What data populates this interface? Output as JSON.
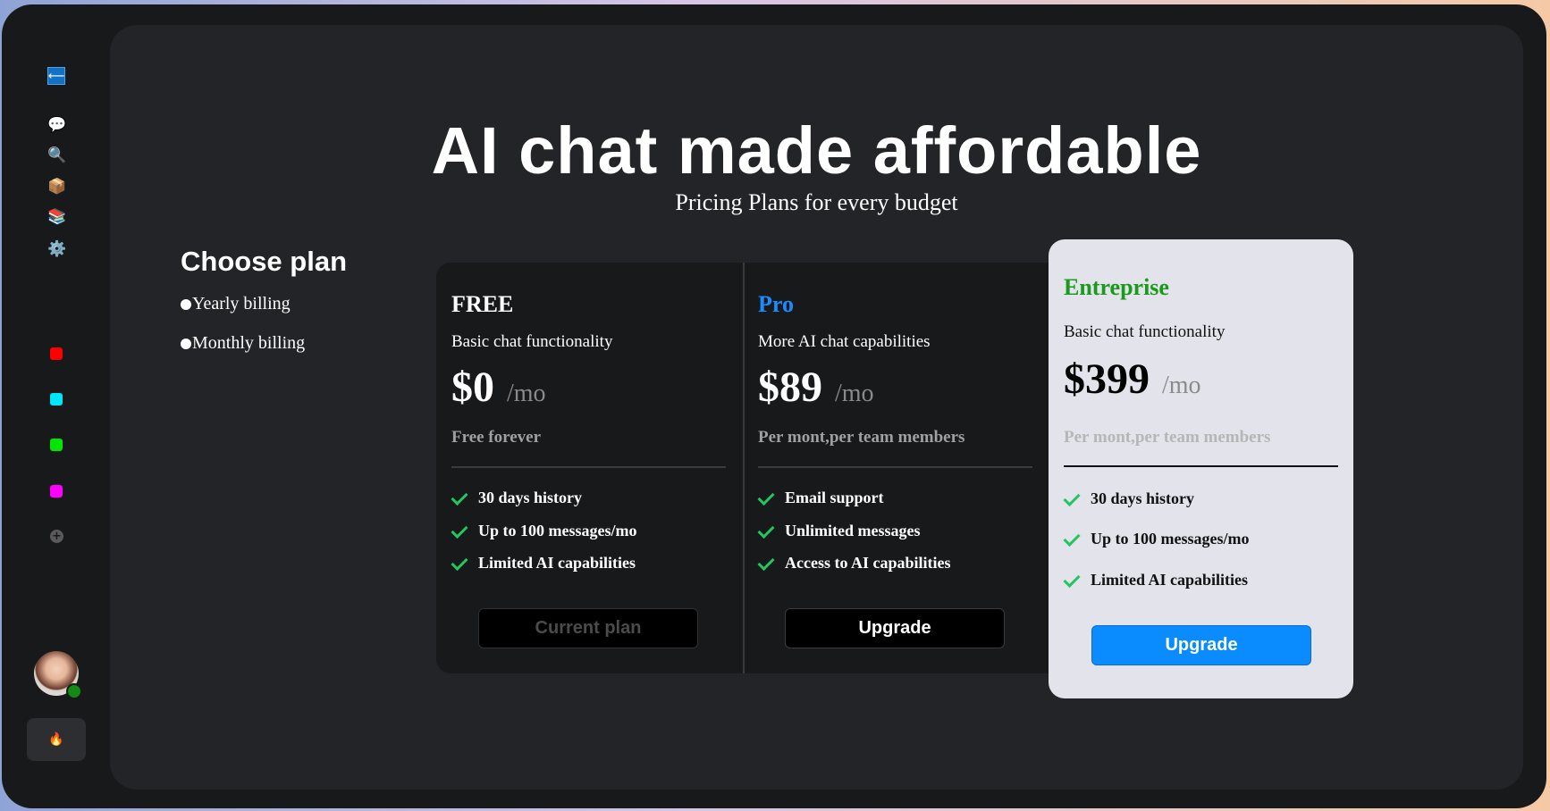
{
  "sidebar": {
    "icons": [
      "collapse-icon",
      "chat-icon",
      "search-icon",
      "package-icon",
      "books-icon",
      "gear-icon"
    ],
    "color_tags": [
      "#ff0000",
      "#00e5ff",
      "#00e600",
      "#ff00ff"
    ],
    "add_icon": "+",
    "fire_icon": "🔥"
  },
  "hero": {
    "title": "AI chat made affordable",
    "subtitle": "Pricing Plans for every budget"
  },
  "billing": {
    "heading": "Choose plan",
    "options": [
      "Yearly billing",
      "Monthly billing"
    ]
  },
  "plans": [
    {
      "name": "FREE",
      "name_color": "#ffffff",
      "description": "Basic chat functionality",
      "price": "$0",
      "per": "/mo",
      "note": "Free forever",
      "features": [
        "30 days history",
        "Up to 100 messages/mo",
        "Limited AI capabilities"
      ],
      "button": "Current plan"
    },
    {
      "name": "Pro",
      "name_color": "#1a8cff",
      "description": "More AI chat capabilities",
      "price": "$89",
      "per": "/mo",
      "note": "Per mont,per team members",
      "features": [
        "Email support",
        "Unlimited messages",
        "Access to AI capabilities"
      ],
      "button": "Upgrade"
    },
    {
      "name": "Entreprise",
      "name_color": "#1a9a1a",
      "description": "Basic chat functionality",
      "price": "$399",
      "per": "/mo",
      "note": "Per mont,per team members",
      "features": [
        "30 days history",
        "Up to 100 messages/mo",
        "Limited AI capabilities"
      ],
      "button": "Upgrade"
    }
  ]
}
